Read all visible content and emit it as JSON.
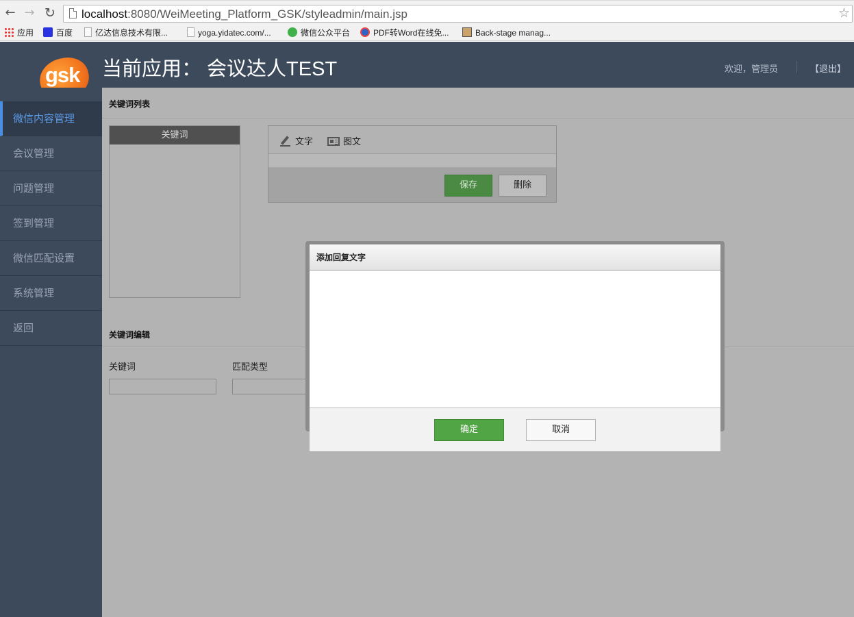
{
  "browser": {
    "url_host": "localhost",
    "url_rest": ":8080/WeiMeeting_Platform_GSK/styleadmin/main.jsp",
    "bookmarks": [
      "应用",
      "百度",
      "亿达信息技术有限...",
      "yoga.yidatec.com/...",
      "微信公众平台",
      "PDF转Word在线免...",
      "Back-stage manag..."
    ]
  },
  "header": {
    "logo_text": "gsk",
    "title": "当前应用： 会议达人TEST",
    "welcome": "欢迎，管理员",
    "logout": "【退出】"
  },
  "sidebar": {
    "items": [
      {
        "label": "微信内容管理",
        "active": true
      },
      {
        "label": "会议管理"
      },
      {
        "label": "问题管理"
      },
      {
        "label": "签到管理"
      },
      {
        "label": "微信匹配设置"
      },
      {
        "label": "系统管理"
      },
      {
        "label": "返回"
      }
    ]
  },
  "keyword_list": {
    "title": "关键词列表",
    "column_header": "关键词"
  },
  "reply_panel": {
    "tab_text": "文字",
    "tab_graphic": "图文",
    "save_label": "保存",
    "delete_label": "删除"
  },
  "keyword_edit": {
    "title": "关键词编辑",
    "keyword_label": "关键词",
    "match_type_label": "匹配类型",
    "keyword_value": "",
    "match_type_value": ""
  },
  "modal": {
    "title": "添加回复文字",
    "textarea_value": "",
    "confirm_label": "确定",
    "cancel_label": "取消"
  },
  "colors": {
    "sidebar_bg": "#3d4a5c",
    "active_menu": "#5d9ce8",
    "confirm_green": "#52a544",
    "overlay_gray": "#b3b3b3"
  }
}
